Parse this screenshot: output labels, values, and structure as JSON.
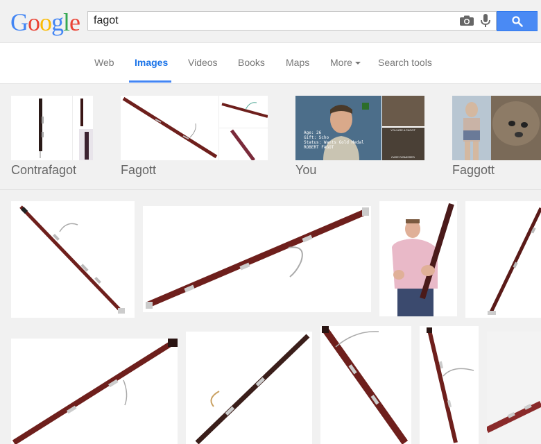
{
  "header": {
    "logo_letters": [
      "G",
      "o",
      "o",
      "g",
      "l",
      "e"
    ],
    "search_value": "fagot"
  },
  "nav": {
    "items": [
      "Web",
      "Images",
      "Videos",
      "Books",
      "Maps",
      "More",
      "Search tools"
    ],
    "active": "Images"
  },
  "related": [
    {
      "label": "Contrafagot"
    },
    {
      "label": "Fagott"
    },
    {
      "label": "You"
    },
    {
      "label": "Faggott"
    }
  ],
  "thumb_you": {
    "caption_lines": [
      "Age: 26",
      "Gift: Scho",
      "Status: Wants Gold Medal",
      "ROBERT FAGOT"
    ],
    "meme_top": "YOU ARE A FAGOT",
    "meme_bottom": "CASE DISMISSED"
  },
  "colors": {
    "bassoon_wood": "#6e1f1c",
    "link_blue": "#1a73e8",
    "search_button": "#4a8af4"
  }
}
